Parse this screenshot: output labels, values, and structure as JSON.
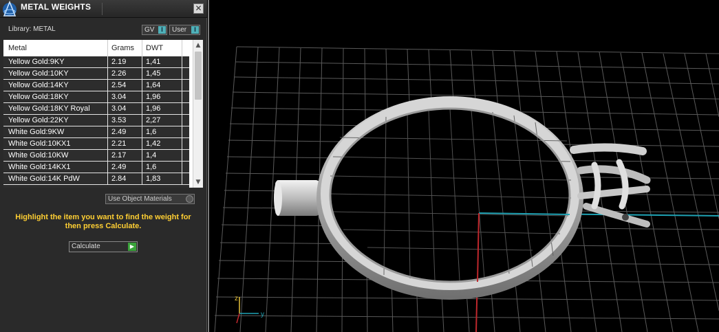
{
  "window": {
    "title": "METAL WEIGHTS",
    "close_glyph": "✕"
  },
  "library": {
    "label": "Library: METAL",
    "toggles": [
      {
        "label": "GV",
        "indicator": "I"
      },
      {
        "label": "User",
        "indicator": "I"
      }
    ]
  },
  "table": {
    "headers": [
      "Metal",
      "Grams",
      "DWT"
    ],
    "rows": [
      {
        "metal": "Yellow Gold:9KY",
        "grams": "2.19",
        "dwt": "1,41"
      },
      {
        "metal": "Yellow Gold:10KY",
        "grams": "2.26",
        "dwt": "1,45"
      },
      {
        "metal": "Yellow Gold:14KY",
        "grams": "2.54",
        "dwt": "1,64"
      },
      {
        "metal": "Yellow Gold:18KY",
        "grams": "3.04",
        "dwt": "1,96"
      },
      {
        "metal": "Yellow Gold:18KY Royal",
        "grams": "3.04",
        "dwt": "1,96"
      },
      {
        "metal": "Yellow Gold:22KY",
        "grams": "3.53",
        "dwt": "2,27"
      },
      {
        "metal": "White Gold:9KW",
        "grams": "2.49",
        "dwt": "1,6"
      },
      {
        "metal": "White Gold:10KX1",
        "grams": "2.21",
        "dwt": "1,42"
      },
      {
        "metal": "White Gold:10KW",
        "grams": "2.17",
        "dwt": "1,4"
      },
      {
        "metal": "White Gold:14KX1",
        "grams": "2.49",
        "dwt": "1,6"
      },
      {
        "metal": "White Gold:14K PdW",
        "grams": "2.84",
        "dwt": "1,83"
      }
    ],
    "scroll_up_glyph": "▲",
    "scroll_down_glyph": "▼"
  },
  "use_object_materials": {
    "label": "Use Object Materials"
  },
  "hint": "Highlight the item you want to find the weight for then press Calculate.",
  "calculate": {
    "label": "Calculate",
    "glyph": "▶"
  },
  "viewport": {
    "axis_labels": {
      "z": "z",
      "y": "y"
    },
    "colors": {
      "grid": "#5a5a5a",
      "axis_x": "#1fa3b5",
      "axis_y": "#c0282d",
      "background": "#000000",
      "ring": "#bdbdbd"
    }
  },
  "icons": {
    "app": "app-logo-icon",
    "close": "close-icon",
    "scroll_up": "chevron-up-icon",
    "scroll_down": "chevron-down-icon",
    "go": "play-icon"
  },
  "colors": {
    "panel_bg": "#2a2a2a",
    "hint_text": "#ffcf33",
    "toggle_indicator": "#4fb0b8",
    "go_button": "#3aa33a"
  }
}
